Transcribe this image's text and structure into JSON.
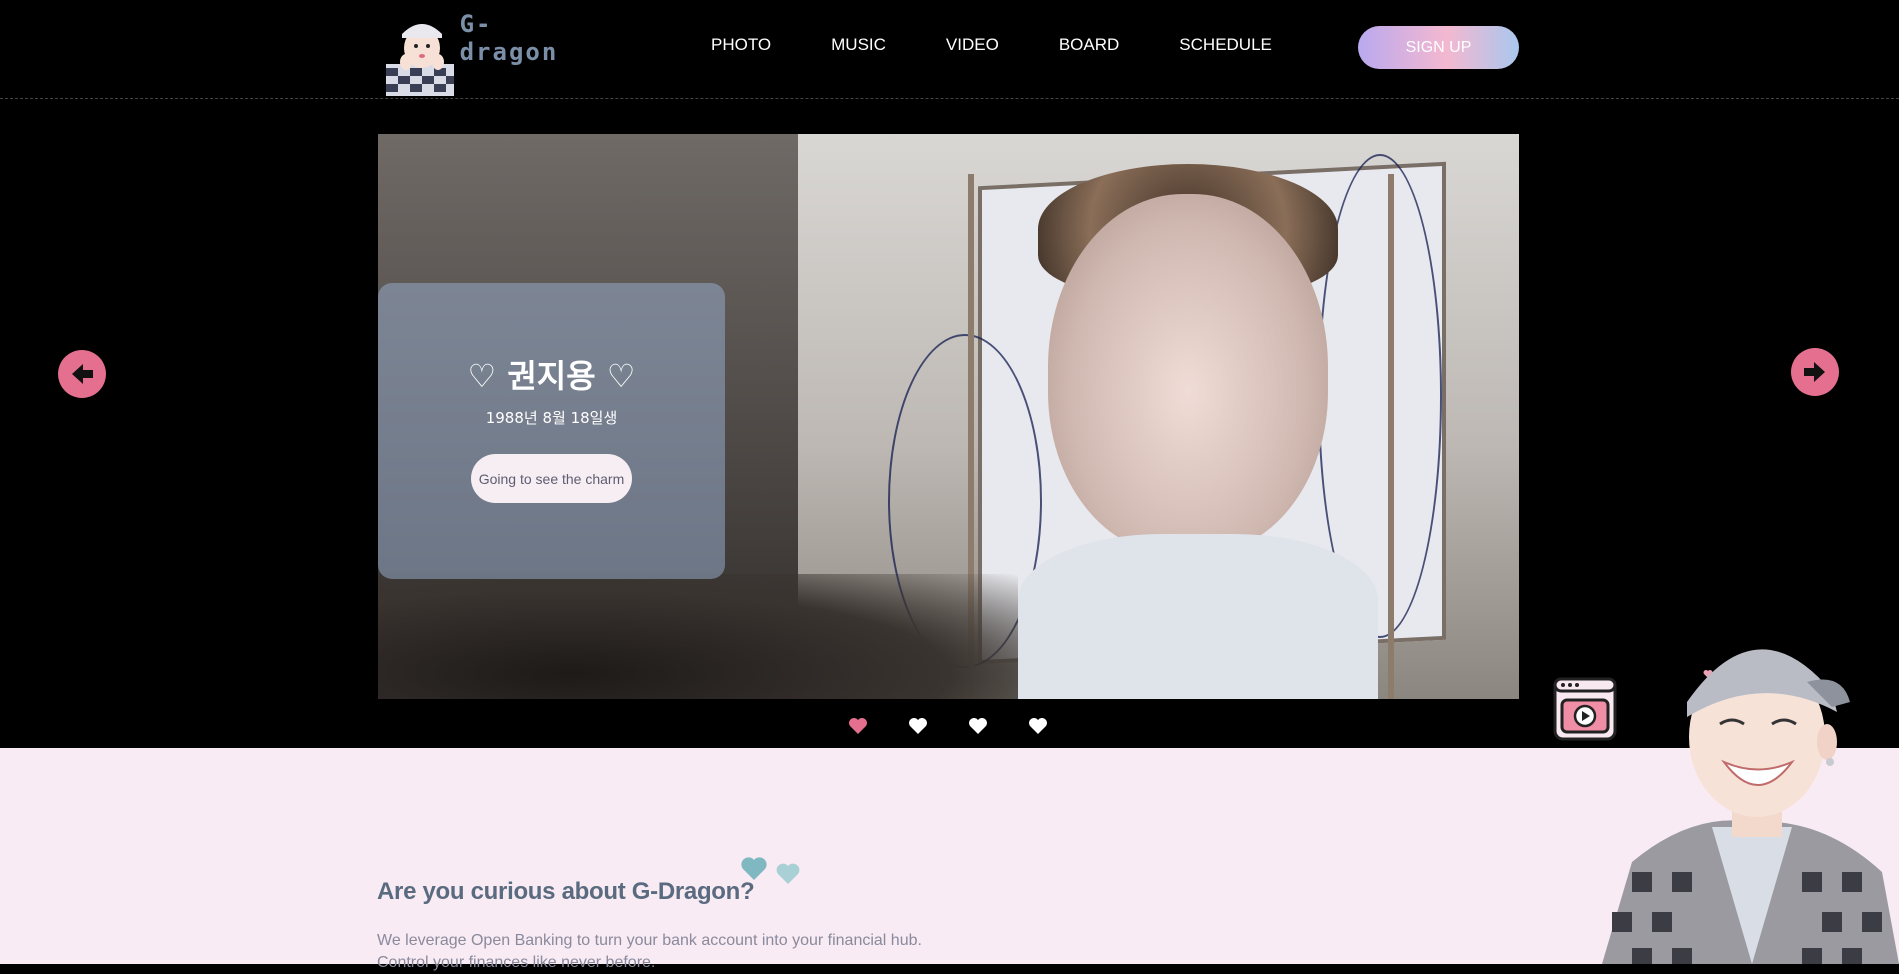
{
  "header": {
    "logo_text": "G-dragon",
    "nav": [
      "PHOTO",
      "MUSIC",
      "VIDEO",
      "BOARD",
      "SCHEDULE"
    ],
    "signup_label": "SIGN UP"
  },
  "hero": {
    "name": "♡ 권지용 ♡",
    "birth": "1988년 8월 18일생",
    "cta_label": "Going to see the charm",
    "active_slide": 1,
    "slide_count": 4
  },
  "about": {
    "title": "Are you curious about G-Dragon?",
    "body": "We leverage Open Banking to turn your bank account into your financial hub. Control your finances like never before."
  },
  "colors": {
    "accent_pink": "#e56f8f",
    "about_bg": "#f8ebf4",
    "title_color": "#5a6b80",
    "teal_heart": "#7fb8c0"
  },
  "icons": {
    "prev": "arrow-left-icon",
    "next": "arrow-right-icon",
    "dot": "heart-icon",
    "video": "video-player-icon"
  }
}
